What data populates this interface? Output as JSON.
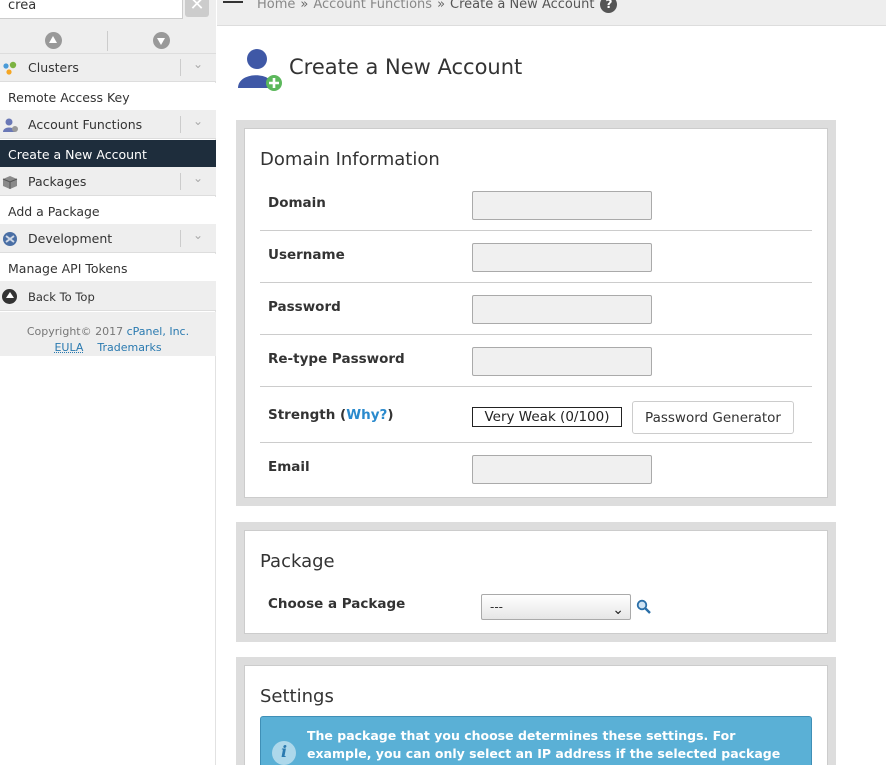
{
  "sidebar": {
    "search": {
      "value": "crea",
      "clear_label": "✕"
    },
    "categories": {
      "clusters": {
        "label": "Clusters",
        "item": "Remote Access Key"
      },
      "account_functions": {
        "label": "Account Functions",
        "item": "Create a New Account"
      },
      "packages": {
        "label": "Packages",
        "item": "Add a Package"
      },
      "development": {
        "label": "Development",
        "item": "Manage API Tokens"
      }
    },
    "back_to_top": "Back To Top",
    "footer": {
      "copyright": "Copyright© 2017",
      "company": "cPanel, Inc.",
      "eula": "EULA",
      "trademarks": "Trademarks"
    },
    "chevron": "⌄"
  },
  "breadcrumb": {
    "home": "Home",
    "section": "Account Functions",
    "current": "Create a New Account",
    "separator": "»",
    "help": "?"
  },
  "page": {
    "title": "Create a New Account"
  },
  "domain_info": {
    "title": "Domain Information",
    "domain_label": "Domain",
    "username_label": "Username",
    "password_label": "Password",
    "retype_label": "Re-type Password",
    "strength_label": "Strength",
    "why_label": "Why?",
    "strength_value": "Very Weak (0/100)",
    "pw_gen_label": "Password Generator",
    "email_label": "Email"
  },
  "package": {
    "title": "Package",
    "choose_label": "Choose a Package",
    "selected": "---"
  },
  "settings": {
    "title": "Settings",
    "info": "The package that you choose determines these settings. For example, you can only select an IP address if the selected package includes a"
  },
  "colors": {
    "sidebar_active": "#1e2d3c",
    "link": "#2a8acd",
    "info_bg": "#5ab0d6"
  }
}
